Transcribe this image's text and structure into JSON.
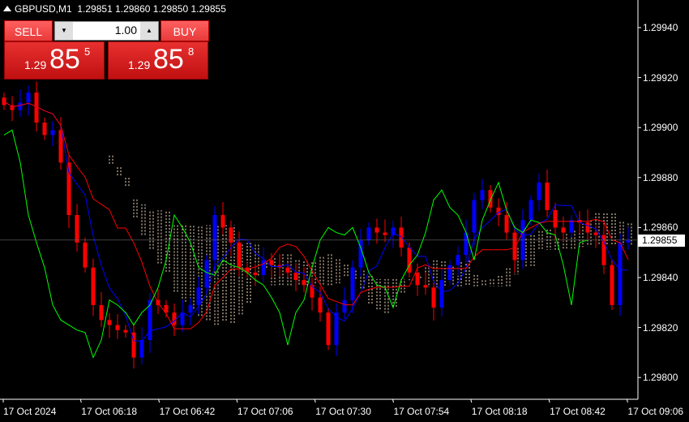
{
  "header": {
    "symbol": "GBPUSD,M1",
    "ohlc": "1.29851 1.29860 1.29850 1.29855"
  },
  "trade_panel": {
    "sell_label": "SELL",
    "buy_label": "BUY",
    "lot": "1.00",
    "sell_price": {
      "prefix": "1.29",
      "big": "85",
      "sup": "5"
    },
    "buy_price": {
      "prefix": "1.29",
      "big": "85",
      "sup": "8"
    }
  },
  "y_axis": {
    "labels": [
      "1.29940",
      "1.29920",
      "1.29900",
      "1.29880",
      "1.29860",
      "1.29840",
      "1.29820",
      "1.29800"
    ],
    "current_price": "1.29855"
  },
  "x_axis": {
    "labels": [
      "17 Oct 2024",
      "17 Oct 06:18",
      "17 Oct 06:42",
      "17 Oct 07:06",
      "17 Oct 07:30",
      "17 Oct 07:54",
      "17 Oct 08:18",
      "17 Oct 08:42",
      "17 Oct 09:06"
    ]
  },
  "colors": {
    "bull": "#0000ff",
    "bear": "#ff0000",
    "tenkan": "#0000ff",
    "kijun": "#ff0000",
    "chikou": "#00ff00",
    "cloud": "#ffe4c4",
    "background": "#000000"
  },
  "chart_data": {
    "type": "candlestick",
    "indicator": "ichimoku",
    "ylim": [
      1.29793,
      1.29951
    ],
    "closes": [
      1.29909,
      1.29907,
      1.2991,
      1.29914,
      1.29902,
      1.29897,
      1.29899,
      1.29886,
      1.29865,
      1.29854,
      1.29844,
      1.29829,
      1.29823,
      1.29821,
      1.29819,
      1.29818,
      1.29808,
      1.29815,
      1.29831,
      1.29829,
      1.29826,
      1.29821,
      1.29826,
      1.29829,
      1.29836,
      1.29847,
      1.29865,
      1.2986,
      1.29854,
      1.29844,
      1.29842,
      1.29841,
      1.29847,
      1.29845,
      1.29844,
      1.29842,
      1.29839,
      1.29837,
      1.29832,
      1.29826,
      1.29813,
      1.29826,
      1.29831,
      1.29844,
      1.29855,
      1.2986,
      1.29858,
      1.29857,
      1.2986,
      1.29852,
      1.29842,
      1.29837,
      1.29836,
      1.29828,
      1.29839,
      1.29845,
      1.29849,
      1.29858,
      1.29871,
      1.29875,
      1.29868,
      1.29865,
      1.29858,
      1.29847,
      1.29863,
      1.29871,
      1.29878,
      1.29867,
      1.2986,
      1.29858,
      1.29863,
      1.29862,
      1.29858,
      1.29857,
      1.29845,
      1.29829,
      1.29854,
      1.29855
    ]
  }
}
